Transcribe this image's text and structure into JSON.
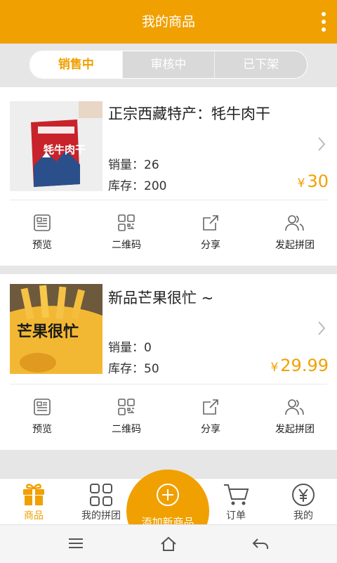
{
  "header": {
    "title": "我的商品",
    "more_icon": "more-vertical-icon"
  },
  "tabs": [
    {
      "label": "销售中",
      "active": true
    },
    {
      "label": "审核中",
      "active": false
    },
    {
      "label": "已下架",
      "active": false
    }
  ],
  "products": [
    {
      "name": "正宗西藏特产：牦牛肉干",
      "sales_label": "销量：",
      "sales": "26",
      "stock_label": "库存：",
      "stock": "200",
      "currency": "¥",
      "price": "30",
      "image_label": "牦牛肉干"
    },
    {
      "name": "新品芒果很忙 ~",
      "sales_label": "销量：",
      "sales": "0",
      "stock_label": "库存：",
      "stock": "50",
      "currency": "¥",
      "price": "29.99",
      "image_label": "芒果很忙"
    }
  ],
  "actions": [
    {
      "label": "预览",
      "icon": "preview-icon"
    },
    {
      "label": "二维码",
      "icon": "qrcode-icon"
    },
    {
      "label": "分享",
      "icon": "share-icon"
    },
    {
      "label": "发起拼团",
      "icon": "group-users-icon"
    }
  ],
  "bottom_nav": [
    {
      "label": "商品",
      "icon": "gift-icon",
      "active": true
    },
    {
      "label": "我的拼团",
      "icon": "grid-icon",
      "active": false
    },
    {
      "label": "订单",
      "icon": "cart-icon",
      "active": false
    },
    {
      "label": "我的",
      "icon": "yen-circle-icon",
      "active": false
    }
  ],
  "fab": {
    "label": "添加新商品",
    "icon": "plus-circle-icon"
  },
  "colors": {
    "accent": "#f0a000",
    "background": "#e6e6e6"
  }
}
